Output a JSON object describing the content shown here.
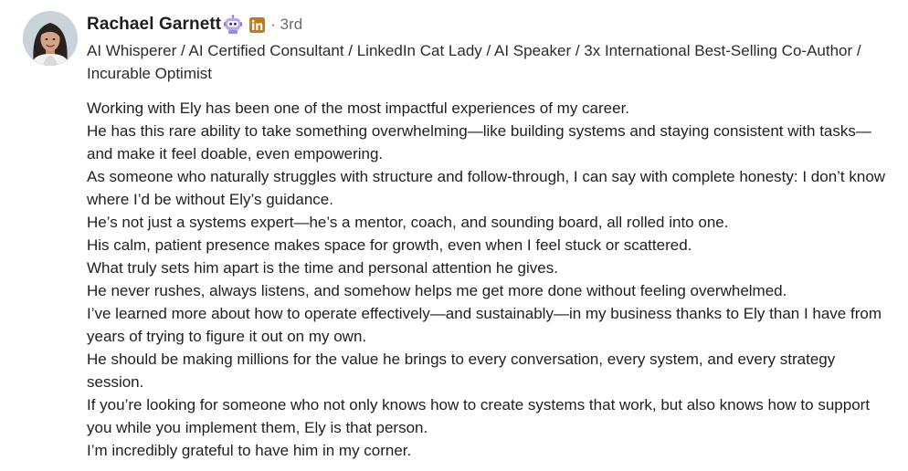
{
  "author": {
    "name": "Rachael Garnett",
    "connection_degree": "· 3rd",
    "headline": "AI Whisperer / AI Certified Consultant / LinkedIn Cat Lady / AI Speaker / 3x International Best-Selling Co-Author / Incurable Optimist",
    "badges": [
      "robot-icon",
      "linkedin-icon"
    ],
    "avatar": "profile-photo"
  },
  "comment": {
    "paragraphs": [
      "Working with Ely has been one of the most impactful experiences of my career.",
      "He has this rare ability to take something overwhelming—like building systems and staying consistent with tasks—and make it feel doable, even empowering.",
      "As someone who naturally struggles with structure and follow-through, I can say with complete honesty: I don’t know where I’d be without Ely’s guidance.",
      "He’s not just a systems expert—he’s a mentor, coach, and sounding board, all rolled into one.",
      "His calm, patient presence makes space for growth, even when I feel stuck or scattered.",
      "What truly sets him apart is the time and personal attention he gives.",
      "He never rushes, always listens, and somehow helps me get more done without feeling overwhelmed.",
      "I’ve learned more about how to operate effectively—and sustainably—in my business thanks to Ely than I have from years of trying to figure it out on my own.",
      "He should be making millions for the value he brings to every conversation, every system, and every strategy session.",
      "If you’re looking for someone who not only knows how to create systems that work, but also knows how to support you while you implement them, Ely is that person.",
      "I’m incredibly grateful to have him in my corner."
    ]
  },
  "colors": {
    "linkedin_badge": "#c37d16",
    "robot_badge": "#8f7ad9",
    "text_primary": "#1f1f1f",
    "text_secondary": "#6b6b6b"
  }
}
